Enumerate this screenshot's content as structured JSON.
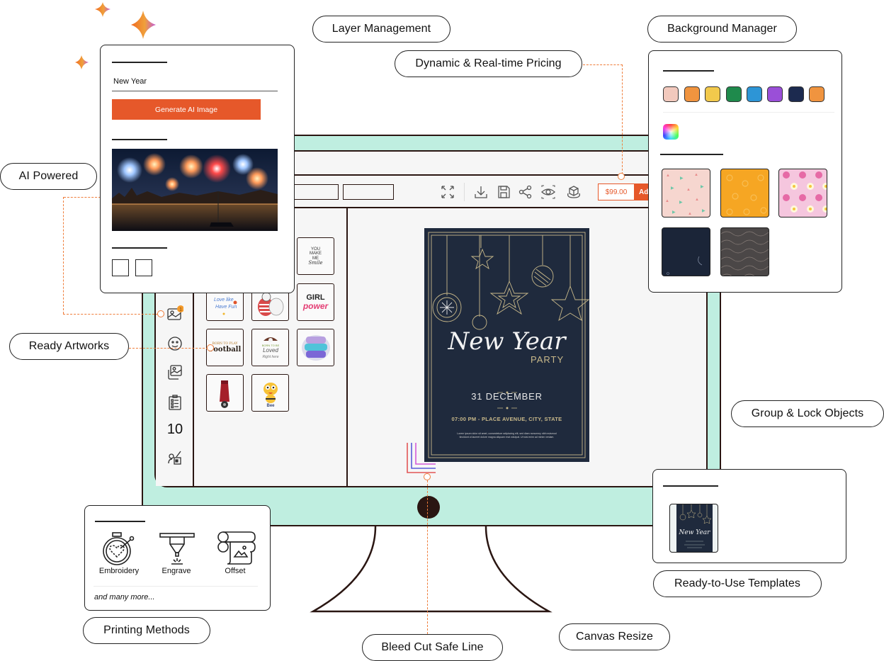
{
  "features": {
    "layer_management": "Layer Management",
    "background_manager": "Background Manager",
    "dynamic_pricing": "Dynamic & Real-time Pricing",
    "ai_powered": "AI Powered",
    "ready_artworks": "Ready Artworks",
    "group_lock": "Group & Lock Objects",
    "ready_templates": "Ready-to-Use Templates",
    "printing_methods": "Printing Methods",
    "bleed_cut": "Bleed Cut Safe Line",
    "canvas_resize": "Canvas Resize"
  },
  "ai_card": {
    "prompt_value": "New Year",
    "generate_button": "Generate AI Image",
    "generated_image": "fireworks-over-harbor-image"
  },
  "toolbar": {
    "icons": [
      "fullscreen-icon",
      "download-icon",
      "save-icon",
      "share-icon",
      "preview-icon",
      "3d-view-icon"
    ],
    "price": "$99.00",
    "add_button": "Ad"
  },
  "sidebar": {
    "icons": [
      "image-upload-icon",
      "emoji-icon",
      "gallery-icon",
      "checklist-icon",
      "text-size-icon",
      "shapes-icon"
    ],
    "text_size_label": "10",
    "badge_color": "#f39a2b"
  },
  "artworks": [
    "you-make-me-smile",
    "love-like-have-fun",
    "cats-illustration",
    "girl-power",
    "born-to-play-football",
    "loved-sticker",
    "graffiti-text",
    "red-scooter",
    "bee-character"
  ],
  "artwork_text": {
    "smile_lines": [
      "YOU",
      "MAKE",
      "ME",
      "Smile"
    ],
    "girl_power": [
      "GIRL",
      "power"
    ],
    "football": "Football",
    "football_top": "BORN TO PLAY"
  },
  "flyer": {
    "title": "New Year",
    "subtitle": "PARTY",
    "date": "31 DECEMBER",
    "place": "07:00 PM - PLACE AVENUE, CITY, STATE",
    "lorem": "Lorem ipsum dolor sit amet, consectetuer adipiscing elit, sed diam nonummy nibh euismod tincidunt ut laoreet dolore magna aliquam erat volutpat. Ut wisi enim ad minim veniam."
  },
  "background_manager": {
    "colors": [
      "#f2c9bd",
      "#f0943f",
      "#f2c94c",
      "#1f8a4c",
      "#2d95d6",
      "#9a4fd8",
      "#1c2a4f",
      "#f0943f"
    ],
    "custom_color": "color-wheel-picker",
    "patterns": [
      "pink-confetti-pattern",
      "orange-floral-pattern",
      "pink-donut-pattern",
      "navy-plain-pattern",
      "grey-lace-pattern"
    ]
  },
  "printing": {
    "methods": [
      "Embroidery",
      "Engrave",
      "Offset"
    ],
    "more": "and many more..."
  },
  "templates": {
    "items": [
      "new-year-party-template"
    ]
  },
  "colors": {
    "accent": "#e6582a",
    "monitor": "#bfeee0",
    "outline": "#2a1612",
    "connector": "#ef7d3a"
  }
}
